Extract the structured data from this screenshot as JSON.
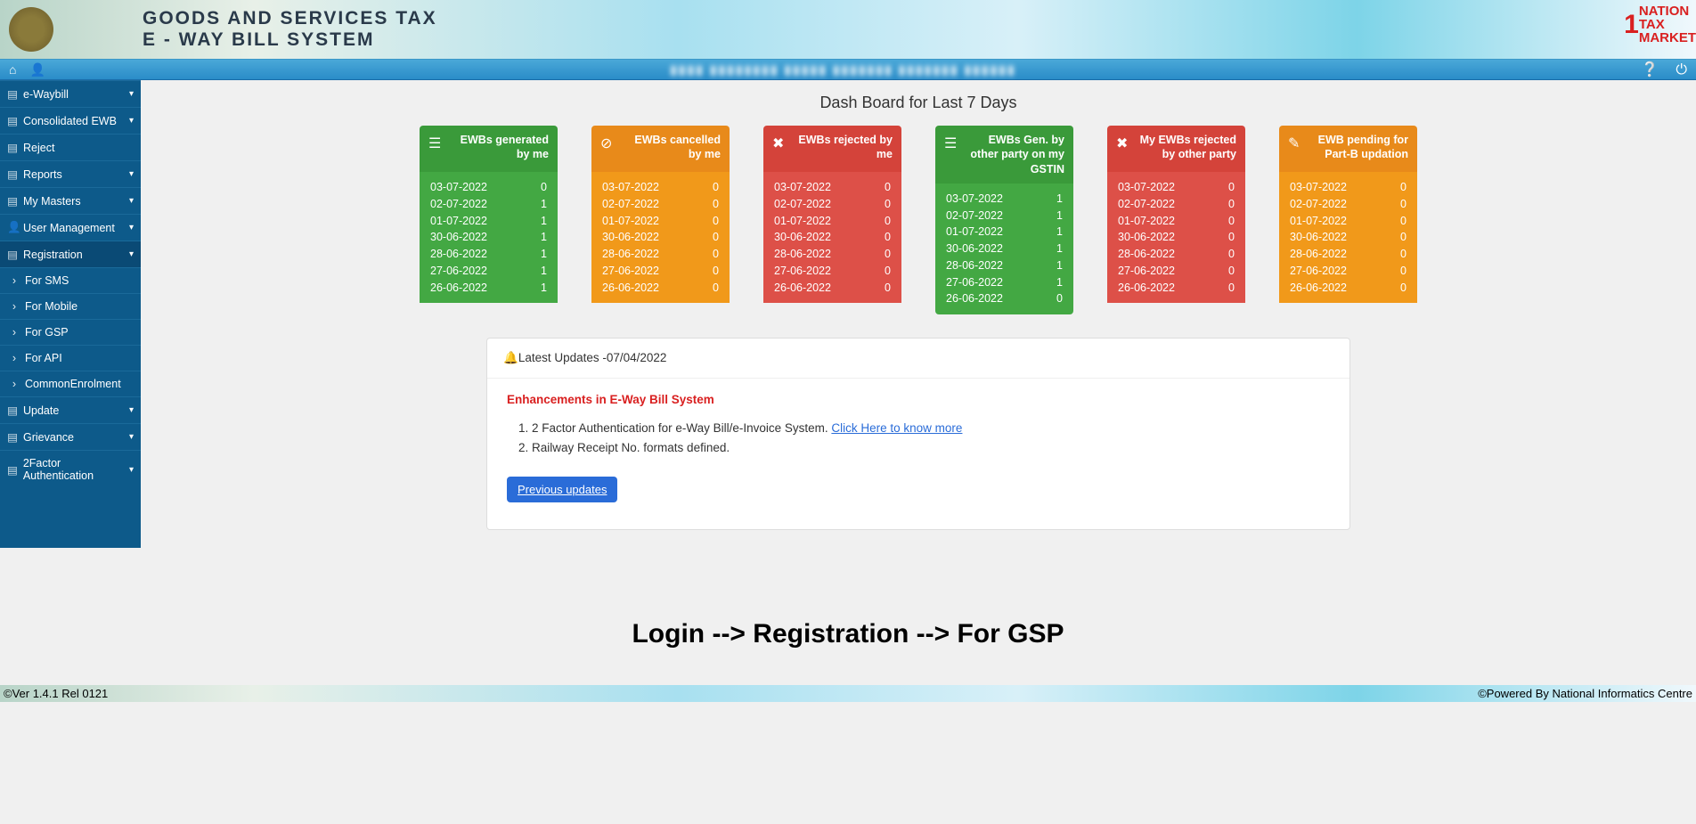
{
  "header": {
    "title1": "GOODS AND SERVICES TAX",
    "title2": "E - WAY BILL SYSTEM",
    "logo_nation": "NATION",
    "logo_tax": "TAX",
    "logo_market": "MARKET"
  },
  "topbar": {
    "center": "▮▮▮▮  ▮▮▮▮▮▮▮▮  ▮▮▮▮▮  ▮▮▮▮▮▮▮  ▮▮▮▮▮▮▮  ▮▮▮▮▮▮"
  },
  "sidebar": [
    {
      "label": "e-Waybill",
      "icon": "▤",
      "chev": true
    },
    {
      "label": "Consolidated EWB",
      "icon": "▤",
      "chev": true
    },
    {
      "label": "Reject",
      "icon": "▤",
      "chev": false
    },
    {
      "label": "Reports",
      "icon": "▤",
      "chev": true
    },
    {
      "label": "My Masters",
      "icon": "▤",
      "chev": true
    },
    {
      "label": "User Management",
      "icon": "👤",
      "chev": true
    },
    {
      "label": "Registration",
      "icon": "▤",
      "chev": true,
      "expanded": true
    },
    {
      "label": "For SMS",
      "icon": "›",
      "sub": true
    },
    {
      "label": "For Mobile",
      "icon": "›",
      "sub": true
    },
    {
      "label": "For GSP",
      "icon": "›",
      "sub": true
    },
    {
      "label": "For API",
      "icon": "›",
      "sub": true
    },
    {
      "label": "CommonEnrolment",
      "icon": "›",
      "sub": true
    },
    {
      "label": "Update",
      "icon": "▤",
      "chev": true
    },
    {
      "label": "Grievance",
      "icon": "▤",
      "chev": true
    },
    {
      "label": "2Factor Authentication",
      "icon": "▤",
      "chev": true
    }
  ],
  "dashboard": {
    "title": "Dash Board for Last 7 Days",
    "cards": [
      {
        "color": "green",
        "icon": "☰",
        "title": "EWBs generated by me",
        "rows": [
          [
            "03-07-2022",
            "0"
          ],
          [
            "02-07-2022",
            "1"
          ],
          [
            "01-07-2022",
            "1"
          ],
          [
            "30-06-2022",
            "1"
          ],
          [
            "28-06-2022",
            "1"
          ],
          [
            "27-06-2022",
            "1"
          ],
          [
            "26-06-2022",
            "1"
          ]
        ]
      },
      {
        "color": "orange",
        "icon": "⊘",
        "title": "EWBs cancelled by me",
        "rows": [
          [
            "03-07-2022",
            "0"
          ],
          [
            "02-07-2022",
            "0"
          ],
          [
            "01-07-2022",
            "0"
          ],
          [
            "30-06-2022",
            "0"
          ],
          [
            "28-06-2022",
            "0"
          ],
          [
            "27-06-2022",
            "0"
          ],
          [
            "26-06-2022",
            "0"
          ]
        ]
      },
      {
        "color": "red",
        "icon": "✖",
        "title": "EWBs rejected by me",
        "rows": [
          [
            "03-07-2022",
            "0"
          ],
          [
            "02-07-2022",
            "0"
          ],
          [
            "01-07-2022",
            "0"
          ],
          [
            "30-06-2022",
            "0"
          ],
          [
            "28-06-2022",
            "0"
          ],
          [
            "27-06-2022",
            "0"
          ],
          [
            "26-06-2022",
            "0"
          ]
        ]
      },
      {
        "color": "green",
        "icon": "☰",
        "title": "EWBs Gen. by other party on my GSTIN",
        "rows": [
          [
            "03-07-2022",
            "1"
          ],
          [
            "02-07-2022",
            "1"
          ],
          [
            "01-07-2022",
            "1"
          ],
          [
            "30-06-2022",
            "1"
          ],
          [
            "28-06-2022",
            "1"
          ],
          [
            "27-06-2022",
            "1"
          ],
          [
            "26-06-2022",
            "0"
          ]
        ]
      },
      {
        "color": "red",
        "icon": "✖",
        "title": "My EWBs rejected by other party",
        "rows": [
          [
            "03-07-2022",
            "0"
          ],
          [
            "02-07-2022",
            "0"
          ],
          [
            "01-07-2022",
            "0"
          ],
          [
            "30-06-2022",
            "0"
          ],
          [
            "28-06-2022",
            "0"
          ],
          [
            "27-06-2022",
            "0"
          ],
          [
            "26-06-2022",
            "0"
          ]
        ]
      },
      {
        "color": "orange",
        "icon": "✎",
        "title": "EWB pending for Part-B updation",
        "rows": [
          [
            "03-07-2022",
            "0"
          ],
          [
            "02-07-2022",
            "0"
          ],
          [
            "01-07-2022",
            "0"
          ],
          [
            "30-06-2022",
            "0"
          ],
          [
            "28-06-2022",
            "0"
          ],
          [
            "27-06-2022",
            "0"
          ],
          [
            "26-06-2022",
            "0"
          ]
        ]
      }
    ]
  },
  "updates": {
    "header": "Latest Updates -07/04/2022",
    "title": "Enhancements in E-Way Bill System",
    "items": [
      {
        "text": "2 Factor Authentication for e-Way Bill/e-Invoice System. ",
        "link": "Click Here to know more"
      },
      {
        "text": "Railway Receipt No. formats defined."
      }
    ],
    "button": "Previous updates"
  },
  "breadcrumb": "Login --> Registration --> For GSP",
  "footer": {
    "left": "©Ver 1.4.1 Rel 0121",
    "right": "©Powered By National Informatics Centre"
  }
}
